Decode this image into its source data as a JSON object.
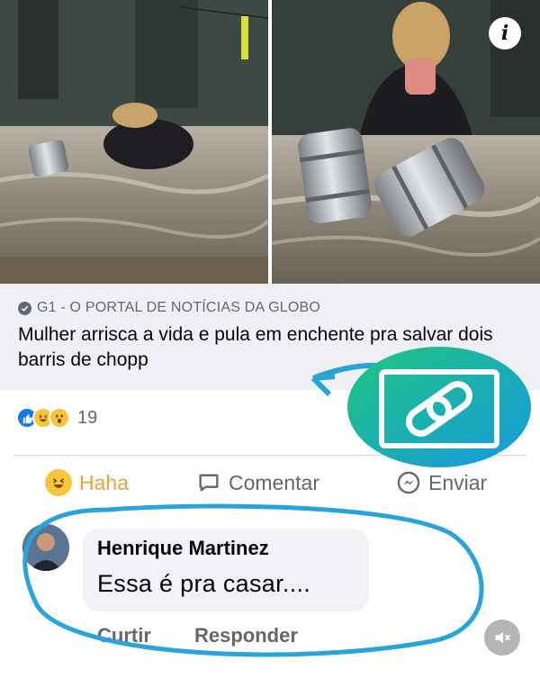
{
  "post": {
    "source": "G1 - O PORTAL DE NOTÍCIAS DA GLOBO",
    "headline": "Mulher arrisca a vida e pula em enchente pra salvar dois barris de chopp"
  },
  "reactions": {
    "types": [
      "like",
      "haha",
      "wow"
    ],
    "count": "19"
  },
  "actions": {
    "haha_label": "Haha",
    "comment_label": "Comentar",
    "send_label": "Enviar"
  },
  "comment": {
    "author": "Henrique Martinez",
    "text": "Essa é pra casar....",
    "like_label": "Curtir",
    "reply_label": "Responder"
  },
  "icons": {
    "info": "info-icon",
    "source": "check-circle-icon",
    "comment": "speech-bubble-icon",
    "send": "messenger-icon",
    "mute": "muted-speaker-icon",
    "link": "link-icon"
  },
  "colors": {
    "haha_active": "#e7a33e",
    "like_blue": "#1877f2",
    "annotation_blue": "#29a3d8",
    "badge_green": "#1fc77f"
  }
}
